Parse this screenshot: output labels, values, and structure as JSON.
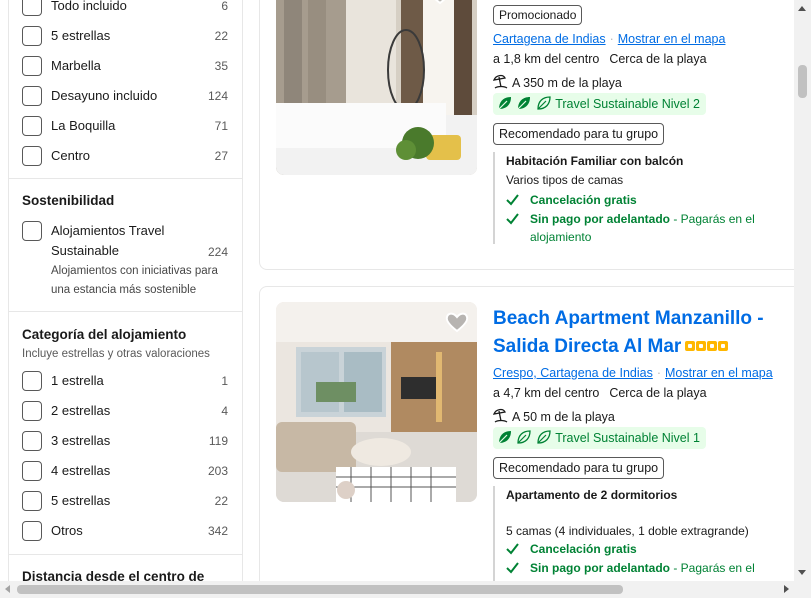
{
  "filters": {
    "top_items": [
      {
        "label": "Todo incluido",
        "count": "6"
      },
      {
        "label": "5 estrellas",
        "count": "22"
      },
      {
        "label": "Marbella",
        "count": "35"
      },
      {
        "label": "Desayuno incluido",
        "count": "124"
      },
      {
        "label": "La Boquilla",
        "count": "71"
      },
      {
        "label": "Centro",
        "count": "27"
      }
    ],
    "sustainability": {
      "title": "Sostenibilidad",
      "item_line1": "Alojamientos Travel",
      "item_line2": "Sustainable",
      "item_count": "224",
      "desc_line1": "Alojamientos con iniciativas para",
      "desc_line2": "una estancia más sostenible"
    },
    "category": {
      "title": "Categoría del alojamiento",
      "subtitle": "Incluye estrellas y otras valoraciones",
      "items": [
        {
          "label": "1 estrella",
          "count": "1"
        },
        {
          "label": "2 estrellas",
          "count": "4"
        },
        {
          "label": "3 estrellas",
          "count": "119"
        },
        {
          "label": "4 estrellas",
          "count": "203"
        },
        {
          "label": "5 estrellas",
          "count": "22"
        },
        {
          "label": "Otros",
          "count": "342"
        }
      ]
    },
    "distance_title": "Distancia desde el centro de"
  },
  "cards": [
    {
      "badge": "Promocionado",
      "location": "Cartagena de Indias",
      "map_link": "Mostrar en el mapa",
      "distance": "a 1,8 km del centro",
      "proximity": "Cerca de la playa",
      "beach": "A 350 m de la playa",
      "sustainability": "Travel Sustainable Nivel 2",
      "leaves_filled": 2,
      "recommended": "Recomendado para tu grupo",
      "room_name": "Habitación Familiar con balcón",
      "beds": "Varios tipos de camas",
      "perk1": "Cancelación gratis",
      "perk2": "Sin pago por adelantado",
      "perk2_note_a": " - Pagarás en el",
      "perk2_note_b": "alojamiento"
    },
    {
      "title_line1": "Beach Apartment Manzanillo -",
      "title_line2": "Salida Directa Al Mar",
      "rating_stars": 4,
      "location": "Crespo, Cartagena de Indias",
      "map_link": "Mostrar en el mapa",
      "distance": "a 4,7 km del centro",
      "proximity": "Cerca de la playa",
      "beach": "A 50 m de la playa",
      "sustainability": "Travel Sustainable Nivel 1",
      "leaves_filled": 1,
      "recommended": "Recomendado para tu grupo",
      "room_name": "Apartamento de 2 dormitorios",
      "beds": "5 camas (4 individuales, 1 doble extragrande)",
      "perk1": "Cancelación gratis",
      "perk2": "Sin pago por adelantado",
      "perk2_note_a": " - Pagarás en el"
    }
  ],
  "colors": {
    "link": "#006ce4",
    "green": "#008234",
    "star": "#ffb700"
  }
}
